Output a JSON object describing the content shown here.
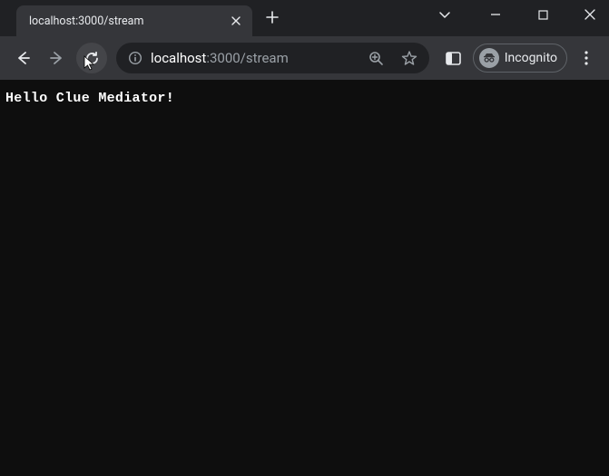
{
  "window": {
    "tab_title": "localhost:3000/stream"
  },
  "toolbar": {
    "url_host": "localhost",
    "url_port_path": ":3000/stream",
    "incognito_label": "Incognito"
  },
  "page": {
    "body_text": "Hello Clue Mediator!"
  }
}
